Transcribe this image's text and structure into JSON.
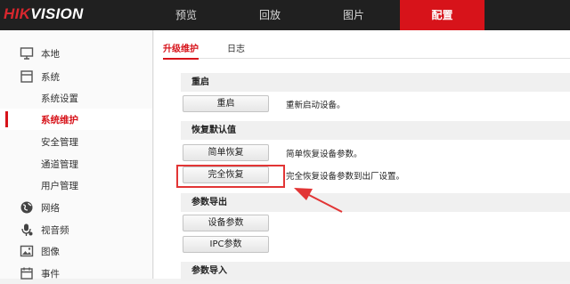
{
  "brand": {
    "logo_red": "HIK",
    "logo_white": "VISION"
  },
  "nav": {
    "items": [
      {
        "label": "预览"
      },
      {
        "label": "回放"
      },
      {
        "label": "图片"
      },
      {
        "label": "配置",
        "active": true
      }
    ]
  },
  "sidebar": {
    "items": [
      {
        "label": "本地",
        "icon": "monitor-icon"
      },
      {
        "label": "系统",
        "icon": "system-icon"
      },
      {
        "label": "系统设置"
      },
      {
        "label": "系统维护",
        "active": true
      },
      {
        "label": "安全管理"
      },
      {
        "label": "通道管理"
      },
      {
        "label": "用户管理"
      },
      {
        "label": "网络",
        "icon": "globe-icon"
      },
      {
        "label": "视音频",
        "icon": "audio-video-icon"
      },
      {
        "label": "图像",
        "icon": "image-icon"
      },
      {
        "label": "事件",
        "icon": "calendar-icon"
      }
    ]
  },
  "tabs": [
    {
      "label": "升级维护",
      "active": true
    },
    {
      "label": "日志"
    }
  ],
  "sections": {
    "reboot": {
      "title": "重启",
      "button": "重启",
      "desc": "重新启动设备。"
    },
    "restore": {
      "title": "恢复默认值",
      "simple_button": "简单恢复",
      "simple_desc": "简单恢复设备参数。",
      "full_button": "完全恢复",
      "full_desc": "完全恢复设备参数到出厂设置。"
    },
    "export": {
      "title": "参数导出",
      "device_button": "设备参数",
      "ipc_button": "IPC参数"
    },
    "import": {
      "title": "参数导入"
    }
  },
  "colors": {
    "accent": "#d7131a",
    "annotation": "#e23535",
    "topbar": "#202020"
  }
}
